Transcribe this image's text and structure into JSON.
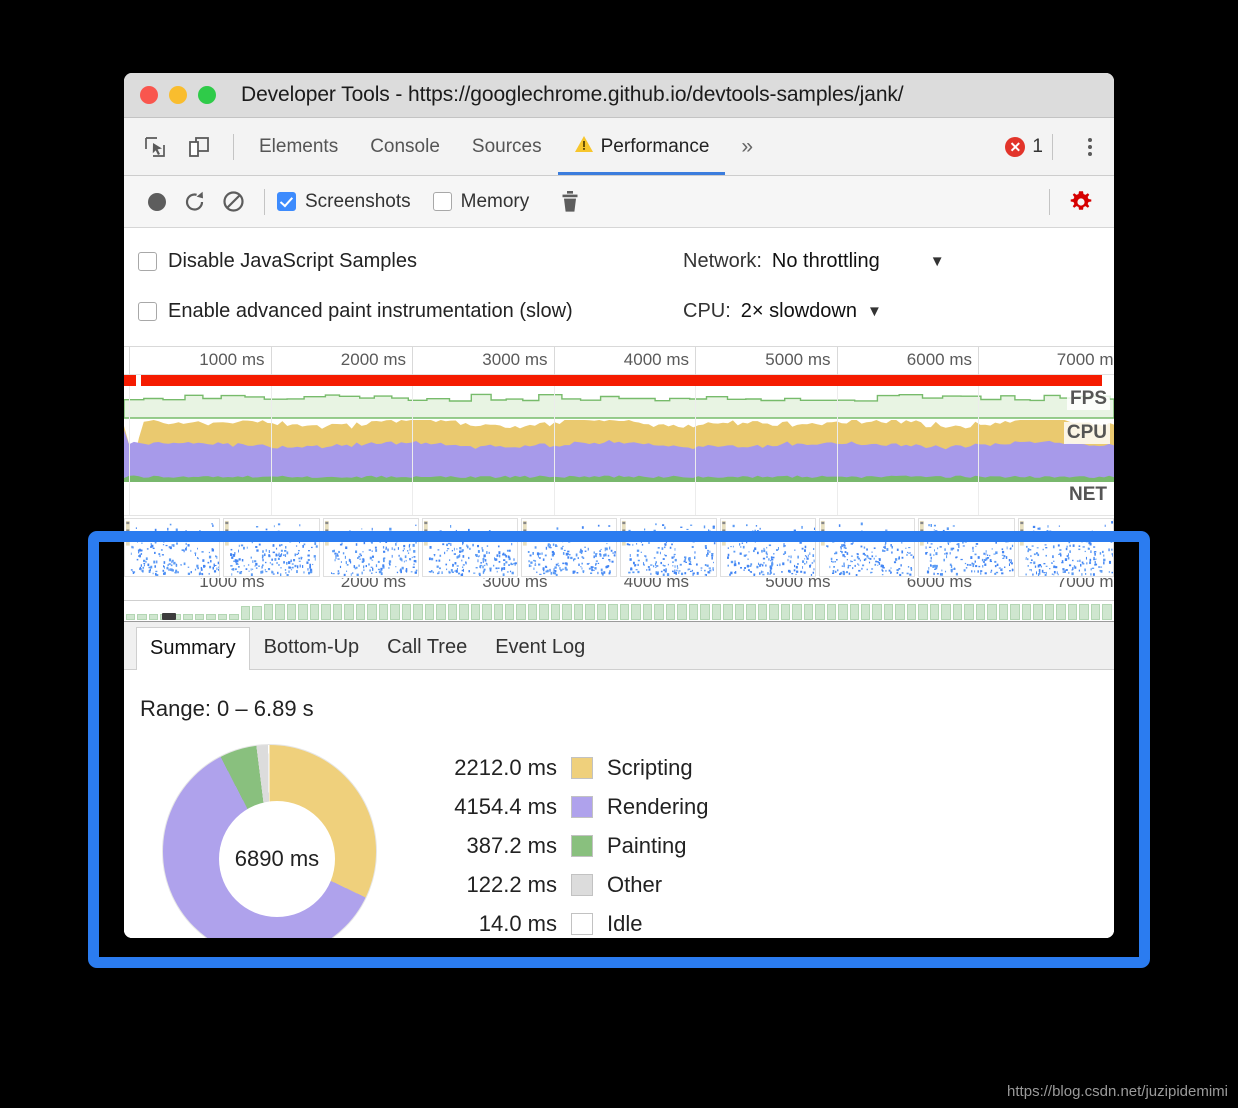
{
  "window": {
    "title": "Developer Tools - https://googlechrome.github.io/devtools-samples/jank/",
    "traffic_lights": [
      "close",
      "minimize",
      "zoom"
    ]
  },
  "tabstrip": {
    "left_icons": [
      {
        "name": "inspect-element-icon",
        "label": "Inspect element"
      },
      {
        "name": "device-toolbar-icon",
        "label": "Toggle device toolbar"
      }
    ],
    "tabs": [
      {
        "label": "Elements",
        "active": false,
        "warning": false
      },
      {
        "label": "Console",
        "active": false,
        "warning": false
      },
      {
        "label": "Sources",
        "active": false,
        "warning": false
      },
      {
        "label": "Performance",
        "active": true,
        "warning": true
      }
    ],
    "more_tabs_label": "»",
    "error_count": "1",
    "menu_label": "Customize and control DevTools"
  },
  "record_toolbar": {
    "record_label": "Record",
    "reload_label": "Start profiling and reload page",
    "clear_label": "Clear",
    "screenshots_label": "Screenshots",
    "screenshots_checked": true,
    "memory_label": "Memory",
    "memory_checked": false,
    "trash_label": "Collect garbage",
    "settings_label": "Capture settings",
    "settings_color": "#d60000"
  },
  "capture_settings": {
    "disable_js_samples_label": "Disable JavaScript Samples",
    "disable_js_samples_checked": false,
    "advanced_paint_label": "Enable advanced paint instrumentation (slow)",
    "advanced_paint_checked": false,
    "network_label": "Network:",
    "network_value": "No throttling",
    "cpu_label": "CPU:",
    "cpu_value": "2× slowdown",
    "caret": "▼"
  },
  "overview": {
    "ruler_ticks": [
      "1000 ms",
      "2000 ms",
      "3000 ms",
      "4000 ms",
      "5000 ms",
      "6000 ms",
      "7000 m"
    ],
    "lane_labels": [
      "FPS",
      "CPU",
      "NET"
    ],
    "colors": {
      "scripting": "#efd07c",
      "rendering": "#afa2ec",
      "painting": "#89c07e",
      "other": "#dcdcdc",
      "idle": "#ffffff",
      "net_red": "#f51b00",
      "frames_green": "#cfe6cf"
    }
  },
  "details": {
    "tabs": [
      {
        "label": "Summary",
        "active": true
      },
      {
        "label": "Bottom-Up",
        "active": false
      },
      {
        "label": "Call Tree",
        "active": false
      },
      {
        "label": "Event Log",
        "active": false
      }
    ],
    "range_text": "Range: 0 – 6.89 s",
    "donut_total": "6890 ms"
  },
  "chart_data": {
    "type": "pie",
    "title": "Range: 0 – 6.89 s",
    "center_label": "6890 ms",
    "unit": "ms",
    "categories": [
      "Scripting",
      "Rendering",
      "Painting",
      "Other",
      "Idle"
    ],
    "values": [
      2212.0,
      4154.4,
      387.2,
      122.2,
      14.0
    ],
    "value_labels": [
      "2212.0 ms",
      "4154.4 ms",
      "387.2 ms",
      "122.2 ms",
      "14.0 ms"
    ],
    "colors": [
      "#efd07c",
      "#afa2ec",
      "#89c07e",
      "#dcdcdc",
      "#ffffff"
    ],
    "total": 6889.8,
    "legend_position": "right",
    "donut": true
  },
  "highlight": {
    "color": "#2b7cf0",
    "target": "summary-details-pane"
  },
  "watermark": "https://blog.csdn.net/juzipidemimi"
}
